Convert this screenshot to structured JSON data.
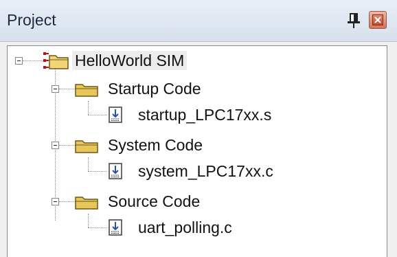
{
  "panel": {
    "title": "Project"
  },
  "tree": {
    "root": {
      "label": "HelloWorld SIM"
    },
    "groups": [
      {
        "label": "Startup Code",
        "file": "startup_LPC17xx.s"
      },
      {
        "label": "System Code",
        "file": "system_LPC17xx.c"
      },
      {
        "label": "Source Code",
        "file": "uart_polling.c"
      }
    ]
  },
  "icons": {
    "pin": "pin-icon",
    "close": "close-icon",
    "project": "project-target-icon",
    "folder": "folder-icon",
    "file": "source-file-icon",
    "collapse": "collapse-minus-icon"
  },
  "colors": {
    "folder": "#e8c75a",
    "close": "#d9745a",
    "titlebar": "#dde5f0"
  }
}
